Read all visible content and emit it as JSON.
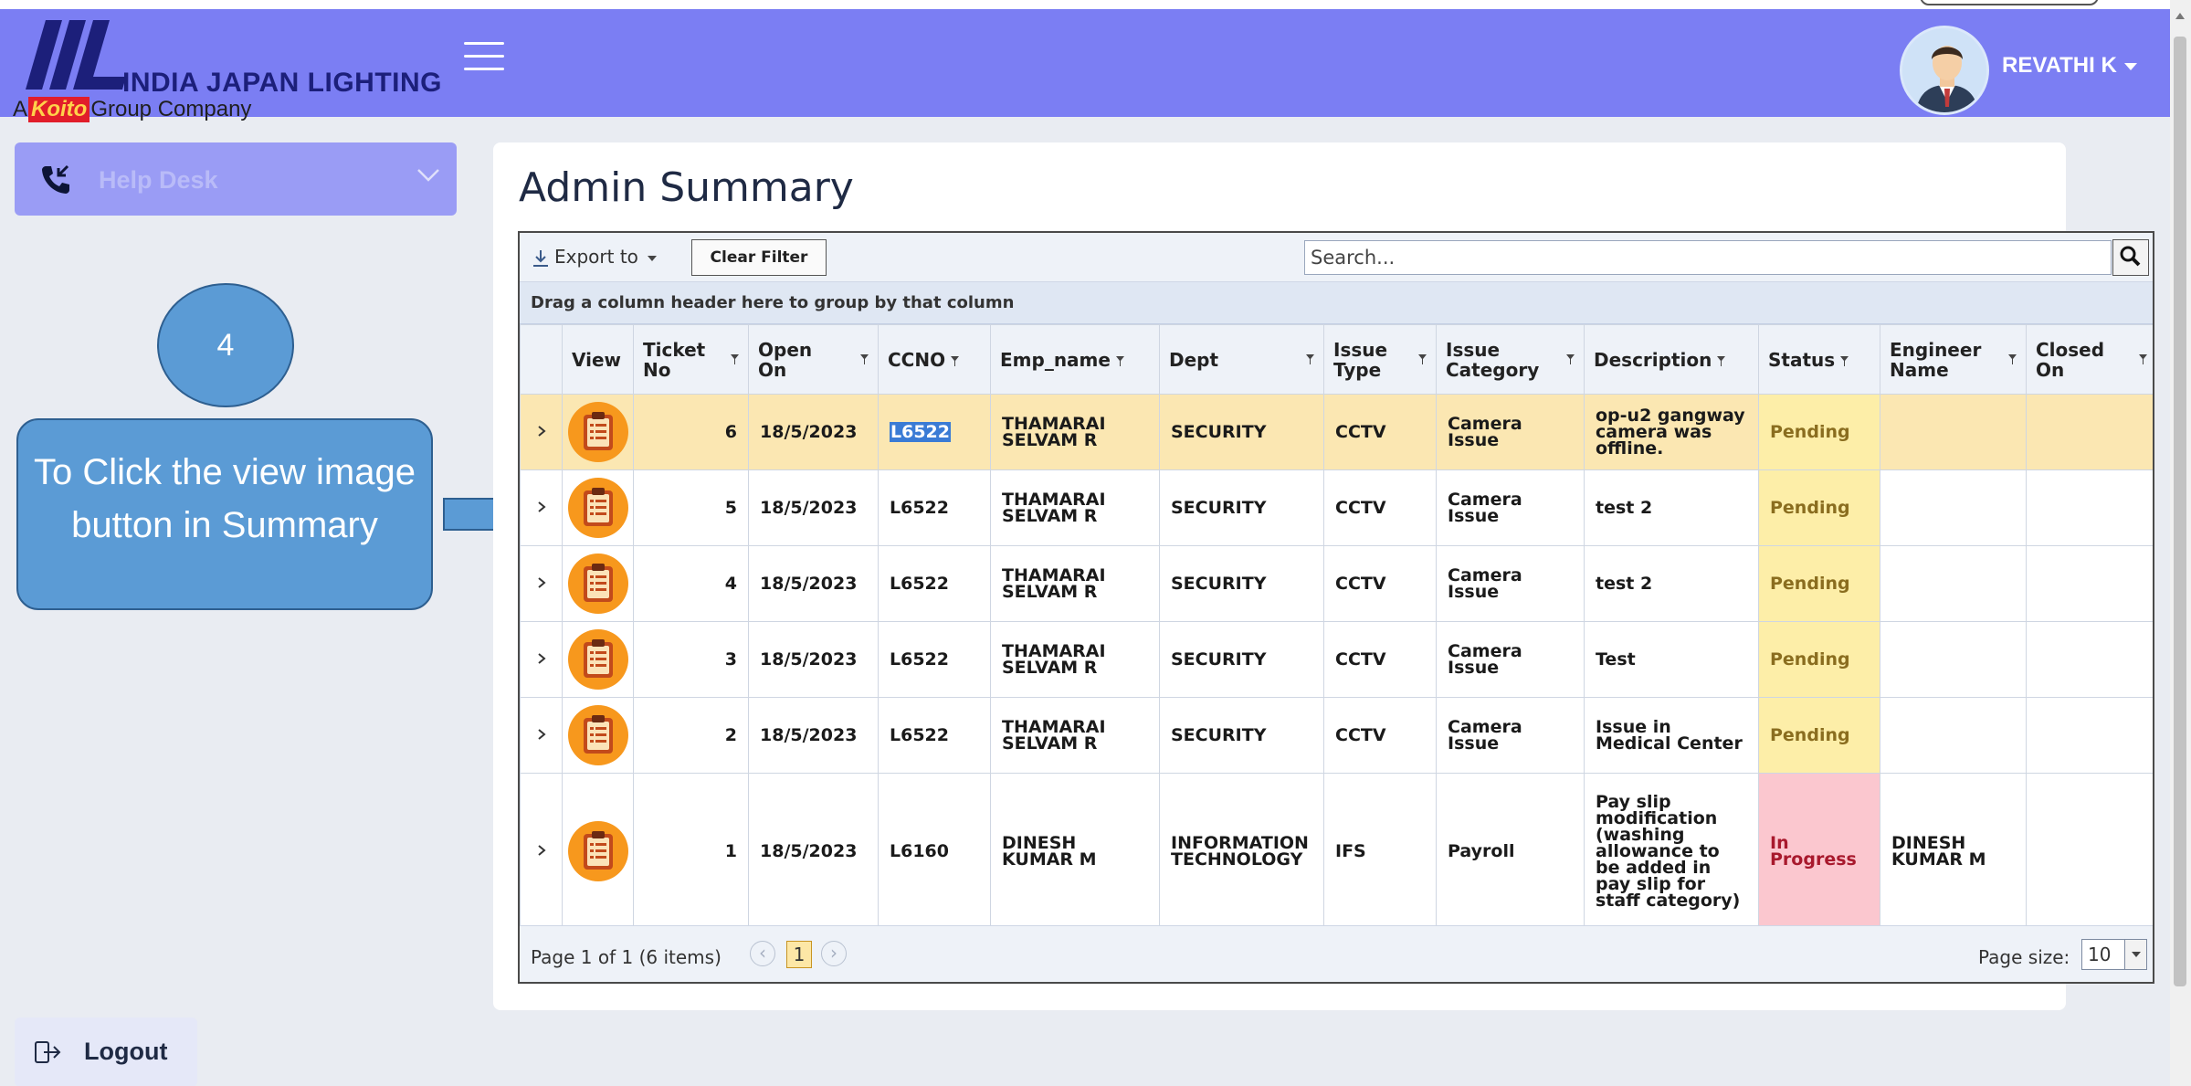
{
  "header": {
    "logo_text": "INDIA JAPAN LIGHTING",
    "logo_sub_prefix": "A",
    "logo_sub_brand": "Koito",
    "logo_sub_suffix": "Group Company",
    "user_name": "REVATHI K",
    "accent_color": "#7b7ef3"
  },
  "sidebar": {
    "helpdesk_label": "Help Desk",
    "logout_label": "Logout"
  },
  "annotation": {
    "step_number": "4",
    "instruction": "To Click the view image button in Summary"
  },
  "main": {
    "title": "Admin Summary",
    "toolbar": {
      "export_label": "Export to",
      "clear_filter_label": "Clear Filter",
      "search_placeholder": "Search..."
    },
    "group_panel_text": "Drag a column header here to group by that column",
    "columns": [
      "View",
      "Ticket No",
      "Open On",
      "CCNO",
      "Emp_name",
      "Dept",
      "Issue Type",
      "Issue Category",
      "Description",
      "Status",
      "Engineer Name",
      "Closed On"
    ],
    "rows": [
      {
        "ticket_no": "6",
        "open_on": "18/5/2023",
        "ccno": "L6522",
        "emp_name": "THAMARAI SELVAM R",
        "dept": "SECURITY",
        "issue_type": "CCTV",
        "issue_category": "Camera Issue",
        "description": "op-u2 gangway camera was offline.",
        "status": "Pending",
        "engineer": "",
        "closed_on": ""
      },
      {
        "ticket_no": "5",
        "open_on": "18/5/2023",
        "ccno": "L6522",
        "emp_name": "THAMARAI SELVAM R",
        "dept": "SECURITY",
        "issue_type": "CCTV",
        "issue_category": "Camera Issue",
        "description": "test 2",
        "status": "Pending",
        "engineer": "",
        "closed_on": ""
      },
      {
        "ticket_no": "4",
        "open_on": "18/5/2023",
        "ccno": "L6522",
        "emp_name": "THAMARAI SELVAM R",
        "dept": "SECURITY",
        "issue_type": "CCTV",
        "issue_category": "Camera Issue",
        "description": "test 2",
        "status": "Pending",
        "engineer": "",
        "closed_on": ""
      },
      {
        "ticket_no": "3",
        "open_on": "18/5/2023",
        "ccno": "L6522",
        "emp_name": "THAMARAI SELVAM R",
        "dept": "SECURITY",
        "issue_type": "CCTV",
        "issue_category": "Camera Issue",
        "description": "Test",
        "status": "Pending",
        "engineer": "",
        "closed_on": ""
      },
      {
        "ticket_no": "2",
        "open_on": "18/5/2023",
        "ccno": "L6522",
        "emp_name": "THAMARAI SELVAM R",
        "dept": "SECURITY",
        "issue_type": "CCTV",
        "issue_category": "Camera Issue",
        "description": "Issue in Medical Center",
        "status": "Pending",
        "engineer": "",
        "closed_on": ""
      },
      {
        "ticket_no": "1",
        "open_on": "18/5/2023",
        "ccno": "L6160",
        "emp_name": "DINESH KUMAR M",
        "dept": "INFORMATION TECHNOLOGY",
        "issue_type": "IFS",
        "issue_category": "Payroll",
        "description": "Pay slip modification (washing allowance to be added in pay slip for staff category)",
        "status": "In Progress",
        "engineer": "DINESH KUMAR M",
        "closed_on": ""
      }
    ],
    "pager": {
      "info": "Page 1 of 1 (6 items)",
      "current_page": "1",
      "page_size_label": "Page size:",
      "page_size": "10"
    }
  },
  "colors": {
    "pending_bg": "#fdeea8",
    "in_progress_bg": "#fbc7cf",
    "selected_row_bg": "#fbe7b2",
    "view_button": "#f7981d",
    "callout": "#5b9bd5"
  }
}
